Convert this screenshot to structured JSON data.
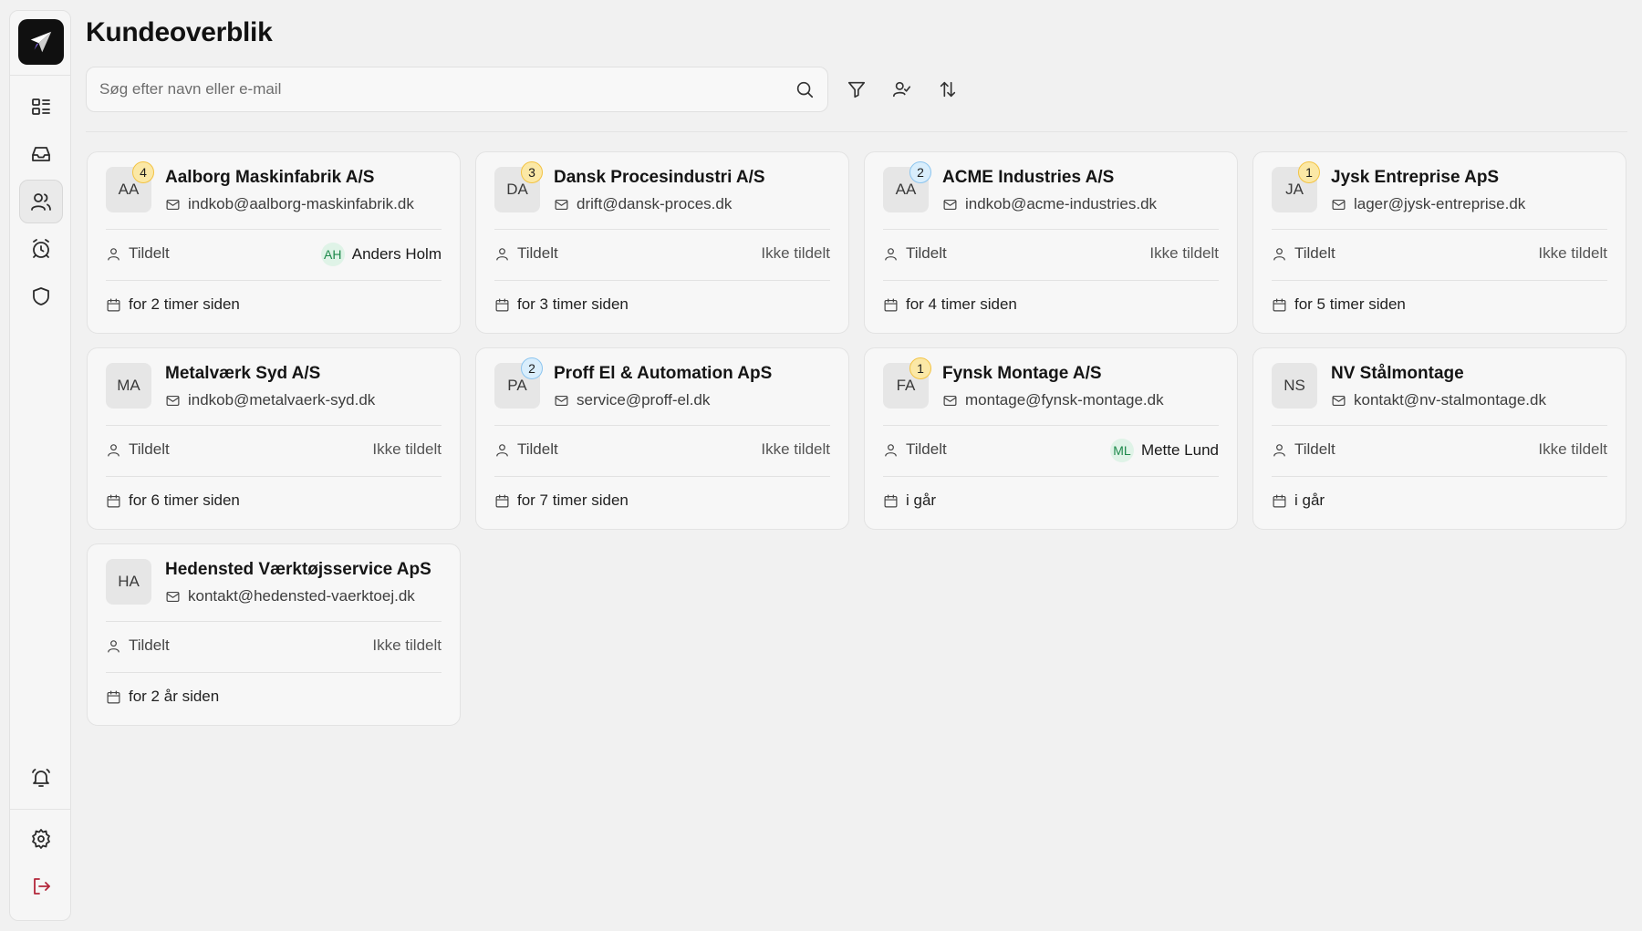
{
  "page": {
    "title": "Kundeoverblik"
  },
  "search": {
    "placeholder": "Søg efter navn eller e-mail",
    "value": ""
  },
  "sidebar": {
    "logo_icon": "paper-plane-icon",
    "nav": [
      {
        "icon": "dashboard-icon",
        "active": false
      },
      {
        "icon": "inbox-icon",
        "active": false
      },
      {
        "icon": "users-icon",
        "active": true
      },
      {
        "icon": "alarm-clock-icon",
        "active": false
      },
      {
        "icon": "shield-icon",
        "active": false
      }
    ],
    "bottom": [
      {
        "icon": "bell-icon"
      },
      {
        "icon": "gear-icon"
      },
      {
        "icon": "logout-icon"
      }
    ]
  },
  "toolbar": {
    "filter_icon": "filter-icon",
    "assign_icon": "user-check-icon",
    "sort_icon": "sort-icon"
  },
  "row_labels": {
    "assigned": "Tildelt"
  },
  "colors": {
    "badge_yellow": "#fbe8a6",
    "badge_blue": "#d9eefc",
    "assignee_avatar": "#dff3e7",
    "logout": "#b3263a"
  },
  "customers": [
    {
      "initials": "AA",
      "name": "Aalborg Maskinfabrik A/S",
      "email": "indkob@aalborg-maskinfabrik.dk",
      "badge": "4",
      "badge_color": "yellow",
      "assignee": "Anders Holm",
      "assignee_initials": "AH",
      "time": "for 2 timer siden"
    },
    {
      "initials": "DA",
      "name": "Dansk Procesindustri A/S",
      "email": "drift@dansk-proces.dk",
      "badge": "3",
      "badge_color": "yellow",
      "assignee": "Ikke tildelt",
      "assignee_initials": "",
      "time": "for 3 timer siden"
    },
    {
      "initials": "AA",
      "name": "ACME Industries A/S",
      "email": "indkob@acme-industries.dk",
      "badge": "2",
      "badge_color": "blue",
      "assignee": "Ikke tildelt",
      "assignee_initials": "",
      "time": "for 4 timer siden"
    },
    {
      "initials": "JA",
      "name": "Jysk Entreprise ApS",
      "email": "lager@jysk-entreprise.dk",
      "badge": "1",
      "badge_color": "yellow",
      "assignee": "Ikke tildelt",
      "assignee_initials": "",
      "time": "for 5 timer siden"
    },
    {
      "initials": "MA",
      "name": "Metalværk Syd A/S",
      "email": "indkob@metalvaerk-syd.dk",
      "badge": "",
      "badge_color": "",
      "assignee": "Ikke tildelt",
      "assignee_initials": "",
      "time": "for 6 timer siden"
    },
    {
      "initials": "PA",
      "name": "Proff El & Automation ApS",
      "email": "service@proff-el.dk",
      "badge": "2",
      "badge_color": "blue",
      "assignee": "Ikke tildelt",
      "assignee_initials": "",
      "time": "for 7 timer siden"
    },
    {
      "initials": "FA",
      "name": "Fynsk Montage A/S",
      "email": "montage@fynsk-montage.dk",
      "badge": "1",
      "badge_color": "yellow",
      "assignee": "Mette Lund",
      "assignee_initials": "ML",
      "time": "i går"
    },
    {
      "initials": "NS",
      "name": "NV Stålmontage",
      "email": "kontakt@nv-stalmontage.dk",
      "badge": "",
      "badge_color": "",
      "assignee": "Ikke tildelt",
      "assignee_initials": "",
      "time": "i går"
    },
    {
      "initials": "HA",
      "name": "Hedensted Værktøjsservice ApS",
      "email": "kontakt@hedensted-vaerktoej.dk",
      "badge": "",
      "badge_color": "",
      "assignee": "Ikke tildelt",
      "assignee_initials": "",
      "time": "for 2 år siden"
    }
  ]
}
